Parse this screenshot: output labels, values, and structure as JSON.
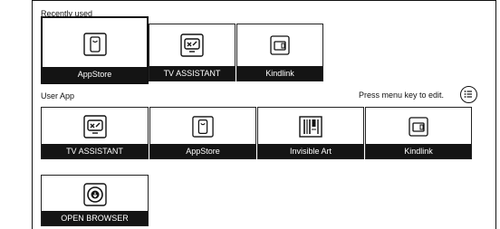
{
  "sections": {
    "recent_label": "Recently used",
    "user_label": "User App"
  },
  "hint": "Press menu key to edit.",
  "recent": [
    {
      "label": "AppStore",
      "icon": "appstore-icon"
    },
    {
      "label": "TV ASSISTANT",
      "icon": "tv-assistant-icon"
    },
    {
      "label": "Kindlink",
      "icon": "kindlink-icon"
    }
  ],
  "user_apps": [
    {
      "label": "TV ASSISTANT",
      "icon": "tv-assistant-icon"
    },
    {
      "label": "AppStore",
      "icon": "appstore-icon"
    },
    {
      "label": "Invisible Art",
      "icon": "invisible-art-icon"
    },
    {
      "label": "Kindlink",
      "icon": "kindlink-icon"
    },
    {
      "label": "OPEN BROWSER",
      "icon": "open-browser-icon"
    }
  ]
}
